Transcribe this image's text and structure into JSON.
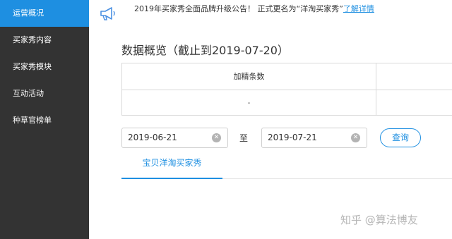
{
  "sidebar": {
    "items": [
      {
        "label": "运营概况",
        "active": true
      },
      {
        "label": "买家秀内容",
        "active": false
      },
      {
        "label": "买家秀模块",
        "active": false
      },
      {
        "label": "互动活动",
        "active": false
      },
      {
        "label": "种草官榜单",
        "active": false
      }
    ]
  },
  "notice": {
    "icon": "megaphone-icon",
    "text": "2019年买家秀全面品牌升级公告！ 正式更名为“洋淘买家秀”",
    "link_label": "了解详情"
  },
  "overview": {
    "title": "数据概览（截止到2019-07-20）",
    "column_header": "加精条数",
    "value": "-"
  },
  "filter": {
    "start_date": "2019-06-21",
    "separator": "至",
    "end_date": "2019-07-21",
    "query_label": "查询",
    "clear_icon": "clear-circle-icon"
  },
  "tabs": [
    {
      "label": "宝贝洋淘买家秀",
      "active": true
    }
  ],
  "watermark": "知乎 @算法博友",
  "colors": {
    "accent": "#1e8fe1",
    "sidebar_bg": "#333333",
    "border": "#d9d9d9"
  }
}
